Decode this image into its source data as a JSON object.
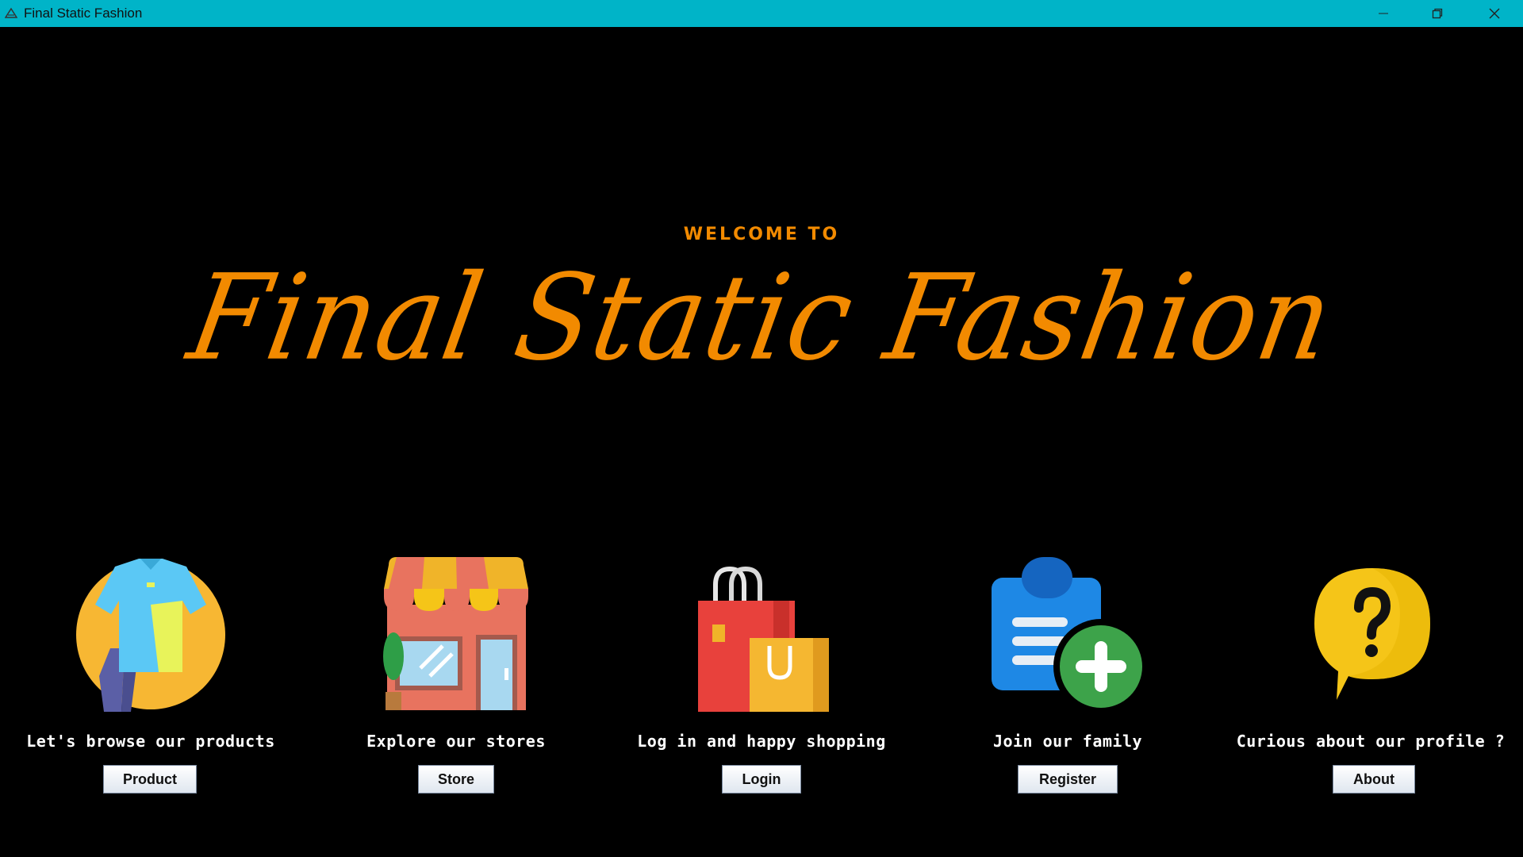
{
  "window": {
    "title": "Final Static Fashion"
  },
  "hero": {
    "welcome": "WELCOME TO",
    "brand": "Final Static Fashion"
  },
  "colors": {
    "titlebar": "#00b4c8",
    "accent": "#f28a00",
    "background": "#000000"
  },
  "features": [
    {
      "icon": "clothes-icon",
      "caption": "Let's browse our products",
      "button": "Product"
    },
    {
      "icon": "store-icon",
      "caption": "Explore our stores",
      "button": "Store"
    },
    {
      "icon": "shopping-bags-icon",
      "caption": "Log in and happy shopping",
      "button": "Login"
    },
    {
      "icon": "clipboard-add-icon",
      "caption": "Join our family",
      "button": "Register"
    },
    {
      "icon": "question-bubble-icon",
      "caption": "Curious about our profile ?",
      "button": "About"
    }
  ]
}
